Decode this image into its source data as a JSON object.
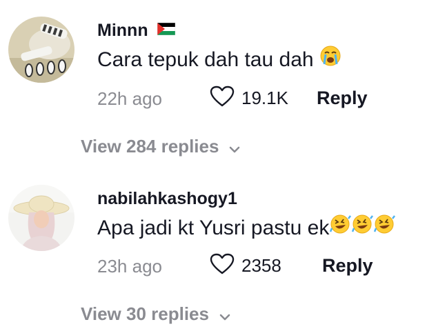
{
  "comments": [
    {
      "username": "Minnn",
      "username_icon": "palestine-flag-icon",
      "text": "Cara tepuk dah tau dah",
      "text_emoji": "loudly-crying-face-emoji",
      "time": "22h ago",
      "likes": "19.1K",
      "reply_label": "Reply",
      "view_replies": "View 284 replies"
    },
    {
      "username": "nabilahkashogy1",
      "text": "Apa jadi kt Yusri pastu ek",
      "text_emoji": "rolling-on-floor-laughing-emoji",
      "time": "23h ago",
      "likes": "2358",
      "reply_label": "Reply",
      "view_replies": "View 30 replies"
    }
  ],
  "colors": {
    "primary_text": "#161823",
    "secondary_text": "#8a8b91",
    "background": "#ffffff"
  }
}
